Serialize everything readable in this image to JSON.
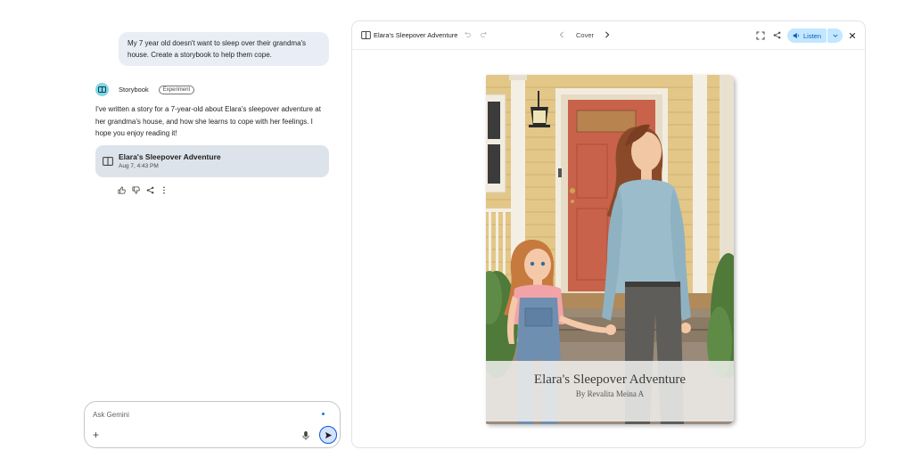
{
  "chat": {
    "user_message": "My 7 year old doesn't want to sleep over their grandma's house. Create a storybook to help them cope.",
    "agent": {
      "name": "Storybook",
      "badge": "Experiment",
      "message": "I've written a story for a 7-year-old about Elara's sleepover adventure at her grandma's house, and how she learns to cope with her feelings. I hope you enjoy reading it!",
      "card": {
        "title": "Elara's Sleepover Adventure",
        "date": "Aug 7, 4:43 PM",
        "icon": "book-icon"
      },
      "actions": [
        "thumbs-up-icon",
        "thumbs-down-icon",
        "share-icon",
        "more-vert-icon"
      ]
    },
    "composer": {
      "placeholder": "Ask Gemini",
      "value": ""
    }
  },
  "canvas": {
    "title": "Elara's Sleepover Adventure",
    "page_label": "Cover",
    "listen_label": "Listen",
    "book": {
      "title": "Elara's Sleepover Adventure",
      "author": "By Revalita Meina A"
    }
  },
  "colors": {
    "accent": "#0b57d0",
    "listen_bg": "#c2e7ff",
    "user_bubble": "#e9eef6",
    "card_bg": "#dde3ea",
    "door": "#c9624a",
    "siding": "#e3c788"
  }
}
